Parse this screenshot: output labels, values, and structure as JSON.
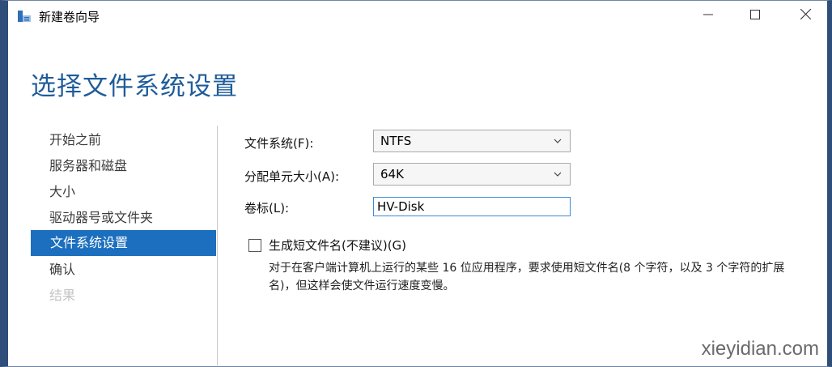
{
  "window": {
    "title": "新建卷向导",
    "app_icon": "disk-wizard-icon",
    "controls": [
      "minimize-icon",
      "maximize-icon",
      "close-icon"
    ]
  },
  "header": {
    "title": "选择文件系统设置"
  },
  "sidebar": {
    "items": [
      {
        "label": "开始之前",
        "state": "normal"
      },
      {
        "label": "服务器和磁盘",
        "state": "normal"
      },
      {
        "label": "大小",
        "state": "normal"
      },
      {
        "label": "驱动器号或文件夹",
        "state": "normal"
      },
      {
        "label": "文件系统设置",
        "state": "active"
      },
      {
        "label": "确认",
        "state": "normal"
      },
      {
        "label": "结果",
        "state": "disabled"
      }
    ]
  },
  "form": {
    "filesystem": {
      "label": "文件系统(F):",
      "value": "NTFS"
    },
    "allocation": {
      "label": "分配单元大小(A):",
      "value": "64K"
    },
    "volume_label": {
      "label": "卷标(L):",
      "value": "HV-Disk"
    },
    "short_names": {
      "label": "生成短文件名(不建议)(G)",
      "checked": false,
      "description": "对于在客户端计算机上运行的某些 16 位应用程序，要求使用短文件名(8 个字符，以及 3 个字符的扩展名)，但这样会使文件运行速度变慢。"
    }
  },
  "watermark": "xieyidian.com",
  "colors": {
    "accent": "#1c6fbf",
    "title": "#1f5c99",
    "frame": "#2f4e79"
  }
}
